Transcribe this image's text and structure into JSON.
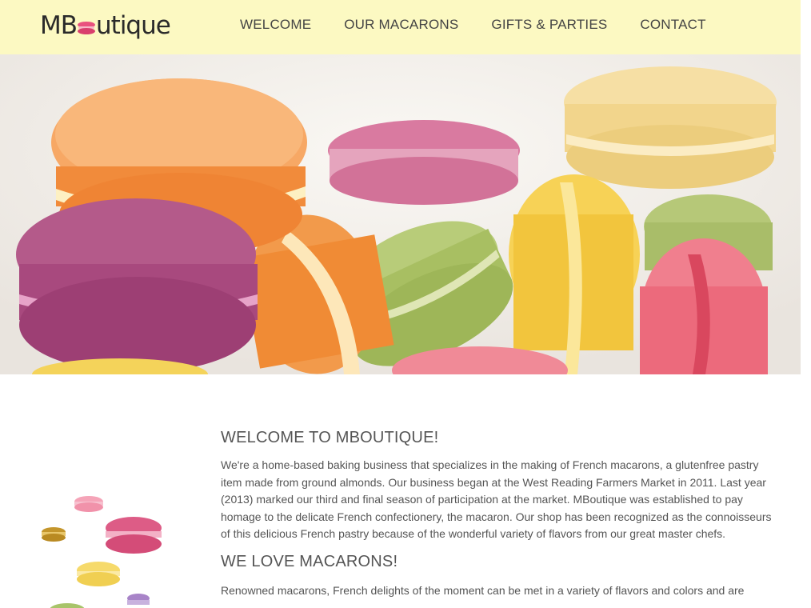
{
  "brand": {
    "logo_text_start": "MB",
    "logo_text_end": "utique"
  },
  "nav": {
    "items": [
      {
        "label": "WELCOME"
      },
      {
        "label": "OUR MACARONS"
      },
      {
        "label": "GIFTS & PARTIES"
      },
      {
        "label": "CONTACT"
      }
    ]
  },
  "colors": {
    "header_bg": "#fcf9c2",
    "text": "#555555",
    "brand_pink": "#e9527e"
  },
  "main": {
    "welcome_heading": "WELCOME TO MBOUTIQUE!",
    "welcome_text": "We're a home-based baking business that specializes in the making of French macarons, a glutenfree pastry item made from ground almonds. Our business began at the West Reading Farmers Market in 2011. Last year (2013) marked our third and final season of participation at the market. MBoutique was established to pay homage to the delicate French confectionery, the macaron. Our shop has been recognized as the connoisseurs of this delicious French pastry because of the wonderful variety of flavors from our great master chefs.",
    "love_heading": "WE LOVE MACARONS!",
    "love_text": "Renowned macarons, French delights of the moment can be met in a variety of flavors and colors and are"
  }
}
